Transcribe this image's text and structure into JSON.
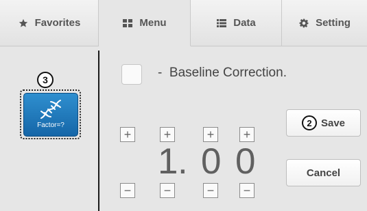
{
  "tabs": [
    {
      "label": "Favorites",
      "icon": "star-icon",
      "active": false
    },
    {
      "label": "Menu",
      "icon": "grid-icon",
      "active": true
    },
    {
      "label": "Data",
      "icon": "list-icon",
      "active": false
    },
    {
      "label": "Setting",
      "icon": "gear-icon",
      "active": false
    }
  ],
  "callouts": {
    "factor": "3",
    "save": "2"
  },
  "factor_button": {
    "label": "Factor=?",
    "icon": "dna-helix-icon"
  },
  "baseline": {
    "dash": "-",
    "label": "Baseline Correction.",
    "checked": false
  },
  "factor_value": {
    "digit1": "1",
    "separator": ".",
    "digit2": "0",
    "digit3": "0"
  },
  "stepper": {
    "plus": "+",
    "minus": "−"
  },
  "buttons": {
    "save": "Save",
    "cancel": "Cancel"
  },
  "colors": {
    "accent": "#1f7bbf",
    "panel": "#e6e6e6"
  }
}
